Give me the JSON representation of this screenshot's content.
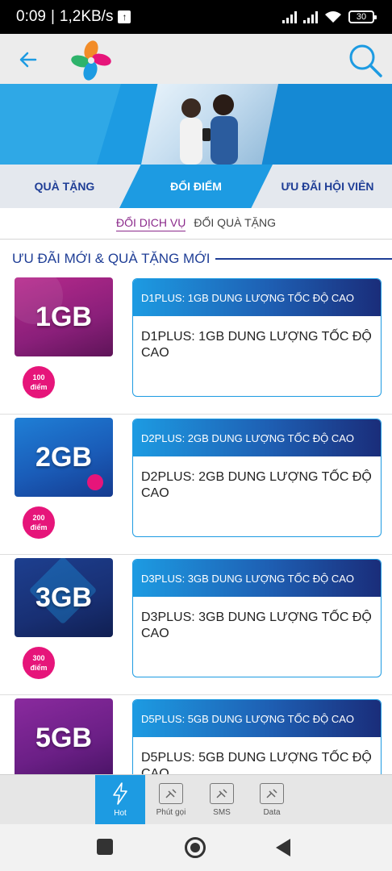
{
  "status_bar": {
    "time": "0:09",
    "speed": "1,2KB/s",
    "battery": "30"
  },
  "tabs": {
    "gifts": "QUÀ TẶNG",
    "points": "ĐỔI ĐIỂM",
    "member": "ƯU ĐÃI HỘI VIÊN"
  },
  "sub_tabs": {
    "service": "ĐỔI DỊCH VỤ",
    "gift": "ĐỔI QUÀ TẶNG"
  },
  "section_title": "ƯU ĐÃI MỚI & QUÀ TẶNG MỚI",
  "offers": [
    {
      "thumb": "1GB",
      "points": "100",
      "unit": "điểm",
      "title": "D1PLUS: 1GB DUNG LƯỢNG TỐC ĐỘ CAO",
      "desc": "D1PLUS: 1GB DUNG LƯỢNG TỐC ĐỘ CAO"
    },
    {
      "thumb": "2GB",
      "points": "200",
      "unit": "điểm",
      "title": "D2PLUS: 2GB DUNG LƯỢNG TỐC ĐỘ CAO",
      "desc": "D2PLUS: 2GB DUNG LƯỢNG TỐC ĐỘ CAO"
    },
    {
      "thumb": "3GB",
      "points": "300",
      "unit": "điểm",
      "title": "D3PLUS: 3GB DUNG LƯỢNG TỐC ĐỘ CAO",
      "desc": "D3PLUS: 3GB DUNG LƯỢNG TỐC ĐỘ CAO"
    },
    {
      "thumb": "5GB",
      "points": "",
      "unit": "",
      "title": "D5PLUS: 5GB DUNG LƯỢNG TỐC ĐỘ CAO",
      "desc": "D5PLUS: 5GB DUNG LƯỢNG TỐC ĐỘ CAO"
    }
  ],
  "bottom_nav": {
    "hot": "Hot",
    "call": "Phút gọi",
    "sms": "SMS",
    "data": "Data"
  },
  "colors": {
    "accent": "#1d9be2",
    "navy": "#1f3e96",
    "badge": "#e6157a",
    "sub_active": "#8b2a8b"
  },
  "icons": [
    "arrow-left-icon",
    "app-logo-icon",
    "search-icon",
    "lightning-icon",
    "gift-icon"
  ]
}
